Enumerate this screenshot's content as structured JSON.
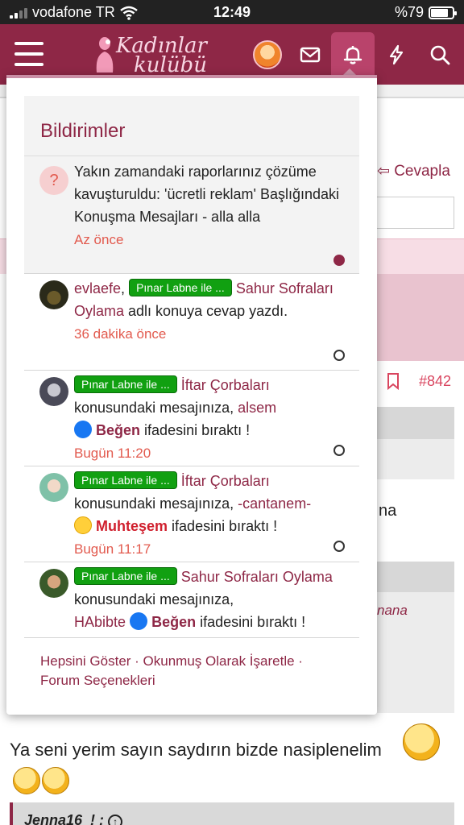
{
  "status_bar": {
    "carrier": "vodafone TR",
    "time": "12:49",
    "battery": "%79",
    "battery_level": 0.79
  },
  "header": {
    "logo_line1": "Kadınlar",
    "logo_line2": "kulübü",
    "icons": [
      "menu-icon",
      "avatar",
      "mail-icon",
      "bell-icon",
      "bolt-icon",
      "search-icon"
    ]
  },
  "background": {
    "reply": "Cevapla",
    "post_number": "#842",
    "partial_na": "na",
    "partial_nana": "nana",
    "post_text": "Ya seni yerim sayın saydırın bizde nasiplenelim",
    "quote_author": "Jenna16_! :"
  },
  "notifications": {
    "title": "Bildirimler",
    "items": [
      {
        "type": "report",
        "text": "Yakın zamandaki raporlarınız çözüme kavuşturuldu: 'ücretli reklam' Başlığındaki Konuşma Mesajları - alla alla",
        "time": "Az önce",
        "unread": true
      },
      {
        "type": "reply",
        "user": "evlaefe",
        "sep": ",",
        "badge": "Pınar Labne ile ...",
        "thread": "Sahur Sofraları Oylama",
        "action": "adlı konuya cevap yazdı.",
        "time": "36 dakika önce",
        "unread": false
      },
      {
        "type": "reaction",
        "badge": "Pınar Labne ile ...",
        "thread": "İftar Çorbaları",
        "mid": "konusundaki mesajınıza,",
        "user": "alsem",
        "reaction": "Beğen",
        "action": "ifadesini bıraktı !",
        "time": "Bugün 11:20",
        "unread": false
      },
      {
        "type": "reaction",
        "badge": "Pınar Labne ile ...",
        "thread": "İftar Çorbaları",
        "mid": "konusundaki mesajınıza,",
        "user": "-cantanem-",
        "reaction": "Muhteşem",
        "action": "ifadesini bıraktı !",
        "time": "Bugün 11:17",
        "unread": false
      },
      {
        "type": "reaction",
        "badge": "Pınar Labne ile ...",
        "thread": "Sahur Sofraları Oylama",
        "mid": "konusundaki mesajınıza,",
        "user": "HAbibte",
        "reaction": "Beğen",
        "action": "ifadesini bıraktı !",
        "unread": false
      }
    ],
    "footer": {
      "show_all": "Hepsini Göster",
      "mark_read": "Okunmuş Olarak İşaretle",
      "options": "Forum Seçenekleri",
      "separator": " · "
    }
  },
  "colors": {
    "brand": "#8e2746",
    "time_red": "#e25a4e",
    "badge_green": "#11a011",
    "active_tab": "#b9436b"
  }
}
